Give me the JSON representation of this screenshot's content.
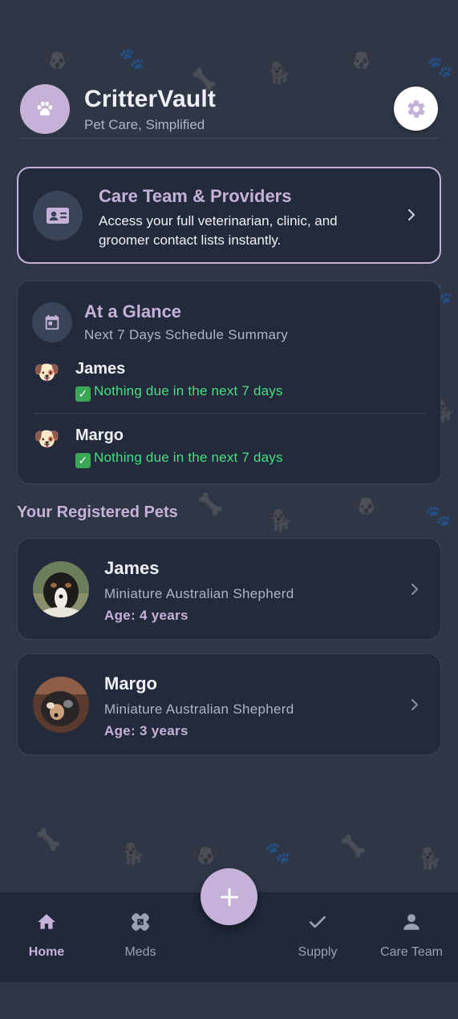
{
  "app": {
    "title": "CritterVault",
    "subtitle": "Pet Care, Simplified",
    "accent_color": "#c6b2d8",
    "success_color": "#4ade80"
  },
  "care_team_card": {
    "title": "Care Team & Providers",
    "description": "Access your full veterinarian, clinic, and groomer contact lists instantly.",
    "icon": "contact-card-icon"
  },
  "glance": {
    "title": "At a Glance",
    "subtitle": "Next 7 Days Schedule Summary",
    "icon": "calendar-icon",
    "rows": [
      {
        "name": "James",
        "status": "Nothing due in the next 7 days"
      },
      {
        "name": "Margo",
        "status": "Nothing due in the next 7 days"
      }
    ]
  },
  "pets_section": {
    "label": "Your Registered Pets",
    "pets": [
      {
        "name": "James",
        "breed": "Miniature Australian Shepherd",
        "age": "Age: 4 years"
      },
      {
        "name": "Margo",
        "breed": "Miniature Australian Shepherd",
        "age": "Age: 3 years"
      }
    ]
  },
  "nav": {
    "items": [
      {
        "label": "Home",
        "icon": "home-icon",
        "active": true
      },
      {
        "label": "Meds",
        "icon": "bandage-icon",
        "active": false
      },
      {
        "label": "Supply",
        "icon": "checkmark-icon",
        "active": false
      },
      {
        "label": "Care Team",
        "icon": "person-icon",
        "active": false
      }
    ],
    "fab_icon": "plus-icon"
  }
}
